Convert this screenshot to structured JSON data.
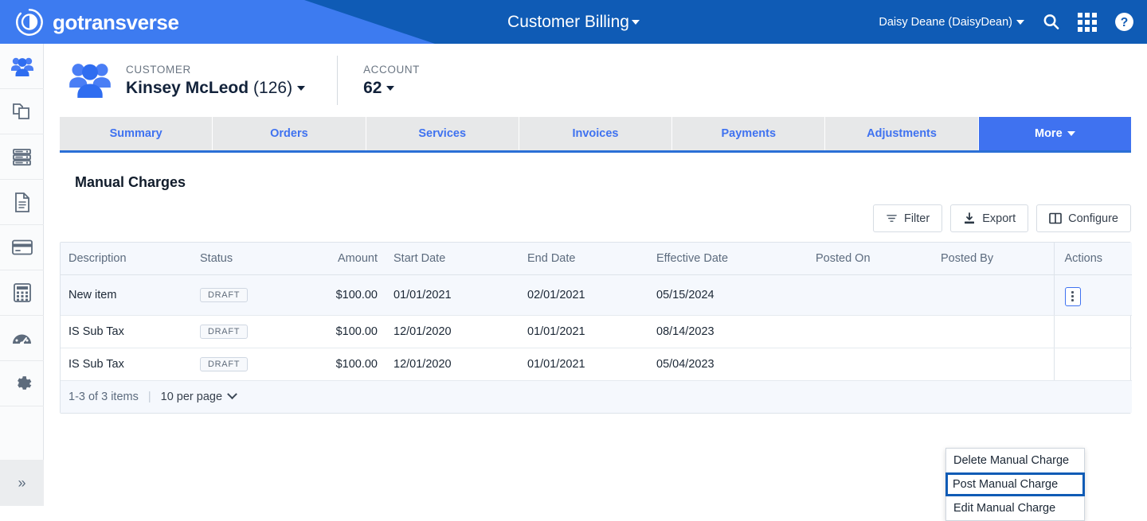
{
  "topbar": {
    "logo_text": "gotransverse",
    "logo_icon": "gotransverse-circle-logo",
    "app_title": "Customer Billing",
    "user_menu": "Daisy Deane (DaisyDean)",
    "search_icon": "search-icon",
    "apps_icon": "app-grid-icon",
    "help_icon": "help-circle-icon",
    "bg_color": "#0f5bb5",
    "wedge_color": "#3d7bf0"
  },
  "rail": {
    "items": [
      {
        "icon": "customers-group-icon",
        "name": "customers"
      },
      {
        "icon": "products-copy-icon",
        "name": "products"
      },
      {
        "icon": "servers-stack-icon",
        "name": "services"
      },
      {
        "icon": "document-icon",
        "name": "invoices"
      },
      {
        "icon": "credit-card-icon",
        "name": "payments"
      },
      {
        "icon": "calculator-icon",
        "name": "billing"
      },
      {
        "icon": "gauge-dashboard-icon",
        "name": "reports"
      },
      {
        "icon": "gear-icon",
        "name": "settings"
      }
    ],
    "expand_icon": "double-chevron-right-icon"
  },
  "context": {
    "customer_label": "CUSTOMER",
    "customer_name": "Kinsey McLeod",
    "customer_id": "(126)",
    "account_label": "ACCOUNT",
    "account_value": "62",
    "avatar_icon": "customers-group-icon"
  },
  "tabs": [
    {
      "label": "Summary",
      "active": false
    },
    {
      "label": "Orders",
      "active": false
    },
    {
      "label": "Services",
      "active": false
    },
    {
      "label": "Invoices",
      "active": false
    },
    {
      "label": "Payments",
      "active": false
    },
    {
      "label": "Adjustments",
      "active": false
    },
    {
      "label": "More",
      "active": true
    }
  ],
  "panel": {
    "title": "Manual Charges",
    "toolbar": [
      {
        "label": "Filter",
        "icon": "filter-icon"
      },
      {
        "label": "Export",
        "icon": "download-export-icon"
      },
      {
        "label": "Configure",
        "icon": "columns-configure-icon"
      }
    ]
  },
  "table": {
    "columns": [
      "Description",
      "Status",
      "Amount",
      "Start Date",
      "End Date",
      "Effective Date",
      "Posted On",
      "Posted By",
      "Actions"
    ],
    "rows": [
      {
        "description": "New item",
        "status": "DRAFT",
        "amount": "$100.00",
        "start_date": "01/01/2021",
        "end_date": "02/01/2021",
        "effective_date": "05/15/2024",
        "posted_on": "",
        "posted_by": "",
        "actions_icon": "kebab-menu-icon"
      },
      {
        "description": "IS Sub Tax",
        "status": "DRAFT",
        "amount": "$100.00",
        "start_date": "12/01/2020",
        "end_date": "01/01/2021",
        "effective_date": "08/14/2023",
        "posted_on": "",
        "posted_by": "",
        "actions_icon": ""
      },
      {
        "description": "IS Sub Tax",
        "status": "DRAFT",
        "amount": "$100.00",
        "start_date": "12/01/2020",
        "end_date": "01/01/2021",
        "effective_date": "05/04/2023",
        "posted_on": "",
        "posted_by": "",
        "actions_icon": ""
      }
    ],
    "footer": {
      "count_text": "1-3 of 3 items",
      "separator": "|",
      "per_page": "10 per page",
      "per_page_icon": "chevron-down-icon"
    }
  },
  "context_menu": {
    "items": [
      {
        "label": "Delete Manual Charge",
        "highlighted": false
      },
      {
        "label": "Post Manual Charge",
        "highlighted": true
      },
      {
        "label": "Edit Manual Charge",
        "highlighted": false
      }
    ],
    "highlight_color": "#0f5bb5"
  }
}
